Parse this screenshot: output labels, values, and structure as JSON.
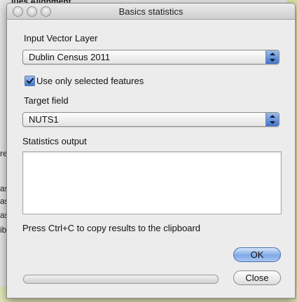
{
  "background": {
    "top_fragment": "lues Alignment",
    "left_fragments": [
      "re",
      "as_",
      "as",
      "as",
      "ib"
    ]
  },
  "dialog": {
    "title": "Basics statistics",
    "input_layer": {
      "label": "Input Vector Layer",
      "value": "Dublin Census 2011"
    },
    "selected_only": {
      "label": "Use only selected features",
      "checked": true
    },
    "target_field": {
      "label": "Target field",
      "value": "NUTS1"
    },
    "output": {
      "label": "Statistics output",
      "value": ""
    },
    "hint": "Press Ctrl+C to copy results to the clipboard",
    "buttons": {
      "ok": "OK",
      "close": "Close"
    },
    "progress": 0
  }
}
